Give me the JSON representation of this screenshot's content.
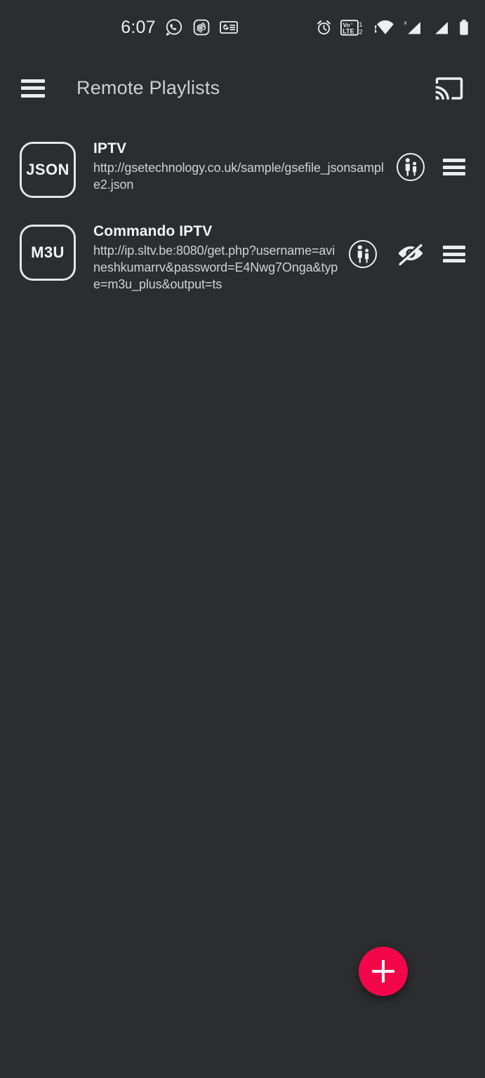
{
  "status_bar": {
    "time": "6:07",
    "left_icons": [
      "whatsapp-icon",
      "shazam-icon",
      "google-news-icon"
    ],
    "right_icons": [
      "alarm-icon",
      "volte-dual-sim-icon",
      "wifi-icon",
      "signal-sim1-no-service-icon",
      "signal-sim2-icon",
      "battery-icon"
    ],
    "volte_label_top": "Vo",
    "volte_label_bottom": "LTE",
    "sim1_label": "1",
    "sim2_label": "2",
    "wifi_x_label": "x"
  },
  "toolbar": {
    "menu_icon": "hamburger-menu-icon",
    "title": "Remote Playlists",
    "cast_icon": "chromecast-icon"
  },
  "playlists": [
    {
      "badge": "JSON",
      "title": "IPTV",
      "url": "http://gsetechnology.co.uk/sample/gsefile_jsonsample2.json",
      "parental_control": true,
      "hidden": false,
      "drag_handle": true
    },
    {
      "badge": "M3U",
      "title": "Commando IPTV",
      "url": "http://ip.sltv.be:8080/get.php?username=avineshkumarrv&password=E4Nwg7Onga&type=m3u_plus&output=ts",
      "parental_control": true,
      "hidden": true,
      "drag_handle": true
    }
  ],
  "fab": {
    "label": "+",
    "name": "add-playlist-button",
    "color": "#f4064b"
  },
  "colors": {
    "background": "#2b2d2e",
    "text_primary": "#f2f4f5",
    "text_secondary": "#cfd2d4",
    "accent": "#f4064b"
  }
}
